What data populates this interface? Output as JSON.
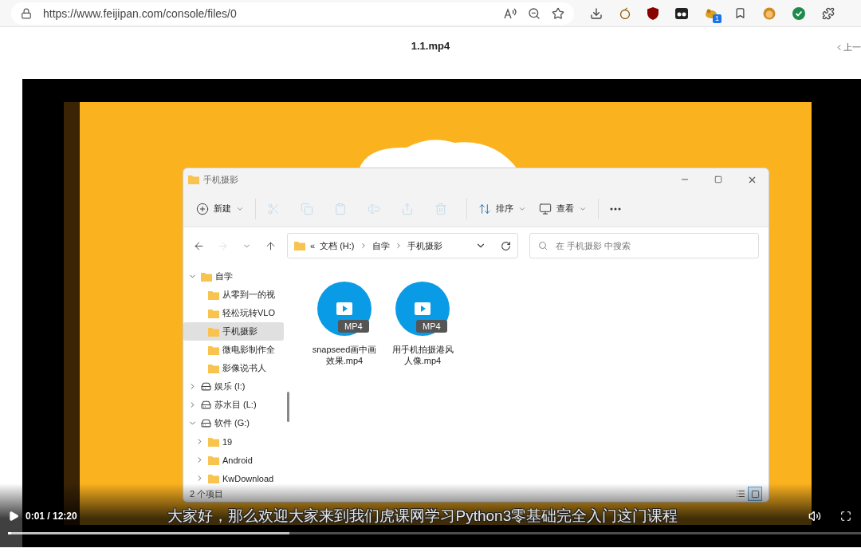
{
  "browser": {
    "url": "https://www.feijipan.com/console/files/0",
    "extension_badge": "1"
  },
  "page": {
    "title": "1.1.mp4",
    "prev_link": "上一"
  },
  "explorer": {
    "title": "手机摄影",
    "toolbar": [
      {
        "kind": "new",
        "label": "新建",
        "disabled": false
      },
      {
        "kind": "cut",
        "disabled": true
      },
      {
        "kind": "copy",
        "disabled": true
      },
      {
        "kind": "paste",
        "disabled": true
      },
      {
        "kind": "rename",
        "disabled": true
      },
      {
        "kind": "share",
        "disabled": true
      },
      {
        "kind": "delete",
        "disabled": true
      },
      {
        "kind": "sort",
        "label": "排序",
        "disabled": false
      },
      {
        "kind": "view",
        "label": "查看",
        "disabled": false
      },
      {
        "kind": "more",
        "disabled": false
      }
    ],
    "nav_buttons": [
      {
        "kind": "back",
        "disabled": false
      },
      {
        "kind": "forward",
        "disabled": true
      },
      {
        "kind": "recent",
        "disabled": false
      },
      {
        "kind": "up",
        "disabled": false
      }
    ],
    "address": {
      "overflow": "«",
      "crumbs": [
        "文档 (H:)",
        "自学",
        "手机摄影"
      ]
    },
    "search": {
      "placeholder": "在 手机摄影 中搜索"
    },
    "tree": [
      {
        "kind": "folder",
        "label": "自学",
        "selected": false,
        "expanded": true,
        "children": [
          {
            "kind": "folder",
            "label": "从零到一的视",
            "selected": false
          },
          {
            "kind": "folder",
            "label": "轻松玩转VLO",
            "selected": false
          },
          {
            "kind": "folder",
            "label": "手机摄影",
            "selected": true
          },
          {
            "kind": "folder",
            "label": "微电影制作全",
            "selected": false
          },
          {
            "kind": "folder",
            "label": "影像说书人",
            "selected": false
          }
        ]
      },
      {
        "kind": "drive",
        "label": "娱乐 (I:)",
        "selected": false,
        "expanded": false
      },
      {
        "kind": "drive",
        "label": "苏水目 (L:)",
        "selected": false,
        "expanded": false
      },
      {
        "kind": "drive",
        "label": "软件 (G:)",
        "selected": false,
        "expanded": true,
        "children": [
          {
            "kind": "folder",
            "label": "19",
            "selected": false,
            "expanded": false
          },
          {
            "kind": "folder",
            "label": "Android",
            "selected": false,
            "expanded": false
          },
          {
            "kind": "folder",
            "label": "KwDownload",
            "selected": false,
            "expanded": false
          }
        ]
      }
    ],
    "files": [
      {
        "name": "snapseed画中画效果.mp4",
        "badge": "MP4"
      },
      {
        "name": "用手机拍摄港风人像.mp4",
        "badge": "MP4"
      }
    ],
    "status": "2 个项目",
    "views": [
      {
        "kind": "details",
        "selected": false
      },
      {
        "kind": "tiles",
        "selected": true
      }
    ]
  },
  "player": {
    "time": "0:01 / 12:20",
    "subtitle": "大家好，那么欢迎大家来到我们虎课网学习Python3零基础完全入门这门课程",
    "progress": {
      "level": 0.003
    },
    "buffered": {
      "level": 0.33
    }
  }
}
